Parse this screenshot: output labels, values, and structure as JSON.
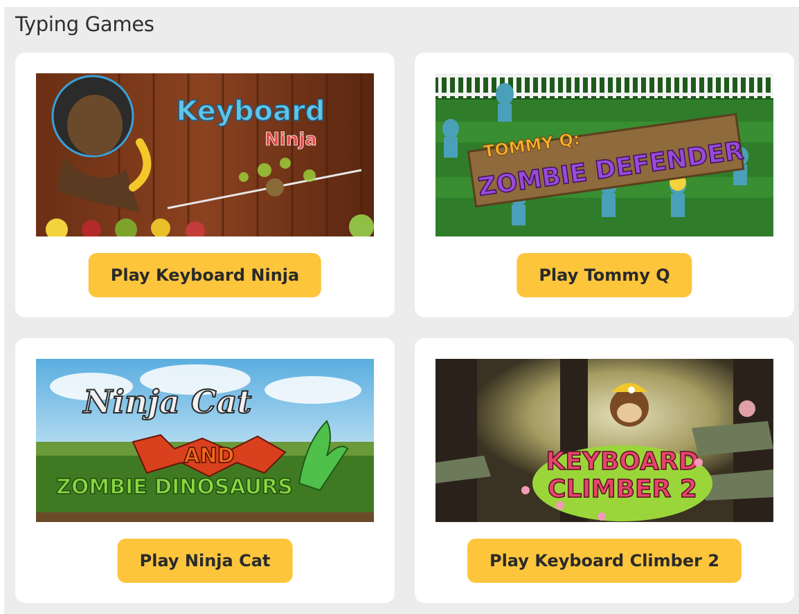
{
  "section": {
    "title": "Typing Games"
  },
  "games": [
    {
      "button_label": "Play Keyboard Ninja",
      "art_title": "Keyboard",
      "art_subtitle": "Ninja"
    },
    {
      "button_label": "Play Tommy Q",
      "art_title": "TOMMY Q:",
      "art_subtitle": "ZOMBIE DEFENDER"
    },
    {
      "button_label": "Play Ninja Cat",
      "art_title": "Ninja Cat",
      "art_and": "AND",
      "art_subtitle": "ZOMBIE DINOSAURS"
    },
    {
      "button_label": "Play Keyboard Climber 2",
      "art_title": "KEYBOARD",
      "art_subtitle": "CLIMBER 2"
    }
  ],
  "colors": {
    "button": "#fdc53c",
    "panel": "#ececec",
    "card": "#ffffff"
  }
}
